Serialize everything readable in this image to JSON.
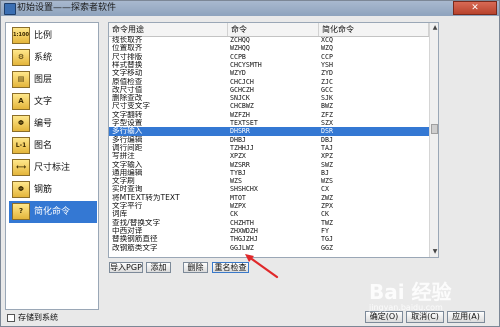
{
  "window": {
    "title": "初始设置——探索者软件",
    "close_label": "✕"
  },
  "sidebar": {
    "items": [
      {
        "label": "比例",
        "icon": "1:100"
      },
      {
        "label": "系统",
        "icon": "⚙"
      },
      {
        "label": "图层",
        "icon": "▤"
      },
      {
        "label": "文字",
        "icon": "A"
      },
      {
        "label": "编号",
        "icon": "Φ"
      },
      {
        "label": "图名",
        "icon": "L-1"
      },
      {
        "label": "尺寸标注",
        "icon": "⟷"
      },
      {
        "label": "钢筋",
        "icon": "Φ"
      },
      {
        "label": "简化命令",
        "icon": "?",
        "selected": true
      }
    ]
  },
  "table": {
    "headers": [
      "命令用途",
      "命令",
      "简化命令"
    ],
    "rows": [
      [
        "线长取齐",
        "ZCHQQ",
        "XCQ"
      ],
      [
        "位置取齐",
        "WZHQQ",
        "WZQ"
      ],
      [
        "尺寸排版",
        "CCPB",
        "CCP"
      ],
      [
        "样式替换",
        "CHCYSMTH",
        "YSH"
      ],
      [
        "文字移动",
        "WZYD",
        "ZYD"
      ],
      [
        "原值检查",
        "CHCJCH",
        "ZJC"
      ],
      [
        "改尺寸值",
        "GCHCZH",
        "GCC"
      ],
      [
        "删除查改",
        "SNJCK",
        "SJK"
      ],
      [
        "尺寸变文字",
        "CHCBWZ",
        "BWZ"
      ],
      [
        "文字翻转",
        "WZFZH",
        "ZFZ"
      ],
      [
        "字型设置",
        "TEXTSET",
        "SZX"
      ],
      [
        "多行输入",
        "DHSRR",
        "DSR"
      ],
      [
        "多行编辑",
        "DHBJ",
        "DBJ"
      ],
      [
        "调行间距",
        "TZHHJJ",
        "TAJ"
      ],
      [
        "写拼注",
        "XPZX",
        "XPZ"
      ],
      [
        "文字输入",
        "WZSRR",
        "SWZ"
      ],
      [
        "通用编辑",
        "TYBJ",
        "BJ"
      ],
      [
        "文字刷",
        "WZS",
        "WZS"
      ],
      [
        "实时查询",
        "SHSHCHX",
        "CX"
      ],
      [
        "将MTEXT转为TEXT",
        "MTOT",
        "ZWZ"
      ],
      [
        "文字平行",
        "WZPX",
        "ZPX"
      ],
      [
        "词库",
        "CK",
        "CK"
      ],
      [
        "查找/替换文字",
        "CHZHTH",
        "TWZ"
      ],
      [
        "中西对译",
        "ZHXWDZH",
        "FY"
      ],
      [
        "替换钢筋直径",
        "THGJZHJ",
        "TGJ"
      ],
      [
        "改钢筋类文字",
        "GGJLWZ",
        "GGZ"
      ]
    ]
  },
  "buttons": {
    "import": "导入PGP",
    "add": "添加",
    "delete": "删除",
    "check": "重名检查",
    "ok": "确定(O)",
    "cancel": "取消(C)",
    "apply": "应用(A)"
  },
  "checkbox": {
    "label": "存储到系统"
  },
  "watermark": {
    "text": "Bai 经验",
    "sub": "jingyan.baidu.com"
  }
}
